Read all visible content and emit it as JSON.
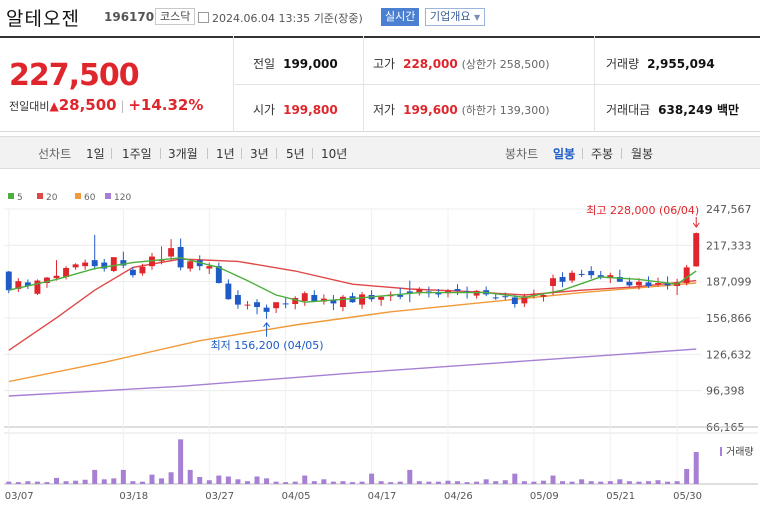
{
  "header": {
    "name": "알테오젠",
    "code": "196170",
    "market": "코스닥",
    "timestamp": "2024.06.04 13:35",
    "basis": "기준(장중)",
    "realtime_label": "실시간",
    "company_info_label": "기업개요"
  },
  "quote": {
    "price": "227,500",
    "change_label": "전일대비",
    "change": "28,500",
    "change_pct": "+14.32%",
    "prev_label": "전일",
    "prev": "199,000",
    "high_label": "고가",
    "high": "228,000",
    "upper_limit_label": "(상한가 258,500)",
    "volume_label": "거래량",
    "volume": "2,955,094",
    "open_label": "시가",
    "open": "199,800",
    "low_label": "저가",
    "low": "199,600",
    "lower_limit_label": "(하한가 139,300)",
    "amount_label": "거래대금",
    "amount": "638,249 백만"
  },
  "tabs": {
    "line_label": "선차트",
    "line_periods": [
      "1일",
      "1주일",
      "3개월",
      "1년",
      "3년",
      "5년",
      "10년"
    ],
    "candle_label": "봉차트",
    "candle_periods": [
      "일봉",
      "주봉",
      "월봉"
    ],
    "active": "일봉"
  },
  "colors": {
    "up": "#e0262d",
    "down": "#1f5bc6",
    "ma5": "#4cae3c",
    "ma20": "#e04848",
    "ma60": "#f09a3a",
    "ma120": "#a77fd4",
    "volume": "#a77fd4"
  },
  "chart_data": {
    "type": "candlestick",
    "ylim": [
      66165,
      247567
    ],
    "y_ticks": [
      "247,567",
      "217,333",
      "187,099",
      "156,866",
      "126,632",
      "96,398",
      "66,165"
    ],
    "x_tick_labels": [
      "03/07",
      "03/18",
      "03/27",
      "04/05",
      "04/17",
      "04/26",
      "05/09",
      "05/21",
      "05/30"
    ],
    "legend": [
      {
        "name": "5"
      },
      {
        "name": "20"
      },
      {
        "name": "60"
      },
      {
        "name": "120"
      }
    ],
    "max_annotation": "최고 228,000 (06/04)",
    "min_annotation": "최저 156,200 (04/05)",
    "volume_label": "거래량",
    "candles": [
      {
        "o": 195500,
        "h": 196000,
        "l": 177500,
        "c": 180000
      },
      {
        "o": 181000,
        "h": 190000,
        "l": 178500,
        "c": 187500
      },
      {
        "o": 186500,
        "h": 189000,
        "l": 181000,
        "c": 183500
      },
      {
        "o": 177000,
        "h": 189000,
        "l": 176000,
        "c": 188000
      },
      {
        "o": 186000,
        "h": 191000,
        "l": 182000,
        "c": 190500
      },
      {
        "o": 190000,
        "h": 205000,
        "l": 188000,
        "c": 192000
      },
      {
        "o": 191000,
        "h": 200000,
        "l": 189000,
        "c": 198500
      },
      {
        "o": 199000,
        "h": 202500,
        "l": 197000,
        "c": 201500
      },
      {
        "o": 200000,
        "h": 205500,
        "l": 197000,
        "c": 203000
      },
      {
        "o": 205000,
        "h": 226000,
        "l": 197000,
        "c": 200000
      },
      {
        "o": 203000,
        "h": 206000,
        "l": 195500,
        "c": 198000
      },
      {
        "o": 196000,
        "h": 207000,
        "l": 195000,
        "c": 207500
      },
      {
        "o": 205000,
        "h": 212000,
        "l": 198500,
        "c": 200500
      },
      {
        "o": 197000,
        "h": 199000,
        "l": 190500,
        "c": 192500
      },
      {
        "o": 194000,
        "h": 202000,
        "l": 192000,
        "c": 199500
      },
      {
        "o": 200000,
        "h": 211000,
        "l": 197000,
        "c": 208000
      },
      {
        "o": 205000,
        "h": 216500,
        "l": 201500,
        "c": 205000
      },
      {
        "o": 208000,
        "h": 222500,
        "l": 205000,
        "c": 215000
      },
      {
        "o": 216000,
        "h": 223000,
        "l": 196500,
        "c": 199000
      },
      {
        "o": 198000,
        "h": 205000,
        "l": 195500,
        "c": 204000
      },
      {
        "o": 205000,
        "h": 209000,
        "l": 196500,
        "c": 200000
      },
      {
        "o": 198000,
        "h": 203000,
        "l": 193500,
        "c": 200000
      },
      {
        "o": 200000,
        "h": 203000,
        "l": 185500,
        "c": 186000
      },
      {
        "o": 185500,
        "h": 189000,
        "l": 172000,
        "c": 172500
      },
      {
        "o": 176000,
        "h": 180000,
        "l": 164500,
        "c": 168000
      },
      {
        "o": 168000,
        "h": 171000,
        "l": 164000,
        "c": 168000
      },
      {
        "o": 170000,
        "h": 172500,
        "l": 160000,
        "c": 166000
      },
      {
        "o": 165500,
        "h": 168000,
        "l": 156200,
        "c": 162000
      },
      {
        "o": 165000,
        "h": 170000,
        "l": 161000,
        "c": 170000
      },
      {
        "o": 169000,
        "h": 174000,
        "l": 165000,
        "c": 168500
      },
      {
        "o": 168500,
        "h": 175000,
        "l": 164000,
        "c": 173500
      },
      {
        "o": 171000,
        "h": 179000,
        "l": 167000,
        "c": 177500
      },
      {
        "o": 176000,
        "h": 180000,
        "l": 170000,
        "c": 171000
      },
      {
        "o": 170500,
        "h": 176500,
        "l": 168000,
        "c": 173000
      },
      {
        "o": 172000,
        "h": 176000,
        "l": 163500,
        "c": 169000
      },
      {
        "o": 166000,
        "h": 176000,
        "l": 162500,
        "c": 174500
      },
      {
        "o": 175000,
        "h": 178000,
        "l": 169500,
        "c": 170000
      },
      {
        "o": 168000,
        "h": 178500,
        "l": 164500,
        "c": 176500
      },
      {
        "o": 176000,
        "h": 180000,
        "l": 170500,
        "c": 172500
      },
      {
        "o": 172000,
        "h": 175000,
        "l": 167000,
        "c": 174500
      },
      {
        "o": 175000,
        "h": 179000,
        "l": 171000,
        "c": 176500
      },
      {
        "o": 176000,
        "h": 182000,
        "l": 172500,
        "c": 174500
      },
      {
        "o": 179000,
        "h": 188000,
        "l": 170000,
        "c": 177000
      },
      {
        "o": 177500,
        "h": 182500,
        "l": 175500,
        "c": 181000
      },
      {
        "o": 179000,
        "h": 183000,
        "l": 174000,
        "c": 177500
      },
      {
        "o": 178000,
        "h": 181000,
        "l": 174000,
        "c": 176500
      },
      {
        "o": 177500,
        "h": 181000,
        "l": 174000,
        "c": 179500
      },
      {
        "o": 181000,
        "h": 185000,
        "l": 176000,
        "c": 179500
      },
      {
        "o": 179000,
        "h": 183000,
        "l": 173000,
        "c": 178000
      },
      {
        "o": 175500,
        "h": 180000,
        "l": 173000,
        "c": 179500
      },
      {
        "o": 180000,
        "h": 183000,
        "l": 175000,
        "c": 176500
      },
      {
        "o": 174000,
        "h": 177500,
        "l": 172000,
        "c": 173500
      },
      {
        "o": 175000,
        "h": 178000,
        "l": 172000,
        "c": 174500
      },
      {
        "o": 174000,
        "h": 176000,
        "l": 165500,
        "c": 168500
      },
      {
        "o": 169000,
        "h": 177000,
        "l": 166000,
        "c": 175000
      },
      {
        "o": 176000,
        "h": 180500,
        "l": 173000,
        "c": 176500
      },
      {
        "o": 174500,
        "h": 177500,
        "l": 170500,
        "c": 176000
      },
      {
        "o": 183500,
        "h": 193000,
        "l": 176000,
        "c": 190000
      },
      {
        "o": 191000,
        "h": 195000,
        "l": 182500,
        "c": 187000
      },
      {
        "o": 188000,
        "h": 196500,
        "l": 186000,
        "c": 194500
      },
      {
        "o": 193500,
        "h": 197000,
        "l": 191000,
        "c": 193000
      },
      {
        "o": 196000,
        "h": 200000,
        "l": 189500,
        "c": 192500
      },
      {
        "o": 192500,
        "h": 196000,
        "l": 189000,
        "c": 191000
      },
      {
        "o": 190000,
        "h": 194500,
        "l": 186000,
        "c": 192500
      },
      {
        "o": 191000,
        "h": 197000,
        "l": 187000,
        "c": 187000
      },
      {
        "o": 187000,
        "h": 190500,
        "l": 182500,
        "c": 184000
      },
      {
        "o": 184000,
        "h": 190000,
        "l": 180500,
        "c": 187000
      },
      {
        "o": 186500,
        "h": 191500,
        "l": 182000,
        "c": 183500
      },
      {
        "o": 185500,
        "h": 190500,
        "l": 183000,
        "c": 186000
      },
      {
        "o": 185500,
        "h": 191500,
        "l": 180500,
        "c": 184000
      },
      {
        "o": 183500,
        "h": 189500,
        "l": 176000,
        "c": 186500
      },
      {
        "o": 186000,
        "h": 201000,
        "l": 184000,
        "c": 199000
      },
      {
        "o": 199800,
        "h": 228000,
        "l": 199600,
        "c": 227500
      }
    ],
    "ma5": [
      [
        0,
        180000
      ],
      [
        5,
        189000
      ],
      [
        9,
        198000
      ],
      [
        13,
        203000
      ],
      [
        18,
        207000
      ],
      [
        22,
        199000
      ],
      [
        25,
        188000
      ],
      [
        28,
        176000
      ],
      [
        31,
        170000
      ],
      [
        36,
        173000
      ],
      [
        43,
        178000
      ],
      [
        50,
        178000
      ],
      [
        54,
        174000
      ],
      [
        58,
        180000
      ],
      [
        62,
        191000
      ],
      [
        66,
        189000
      ],
      [
        70,
        185000
      ],
      [
        72,
        196000
      ]
    ],
    "ma20": [
      [
        0,
        130000
      ],
      [
        5,
        157000
      ],
      [
        9,
        180000
      ],
      [
        13,
        199000
      ],
      [
        18,
        206000
      ],
      [
        24,
        204000
      ],
      [
        30,
        196000
      ],
      [
        36,
        185000
      ],
      [
        42,
        181000
      ],
      [
        48,
        179000
      ],
      [
        54,
        176000
      ],
      [
        60,
        180000
      ],
      [
        66,
        183000
      ],
      [
        72,
        188000
      ]
    ],
    "ma60": [
      [
        0,
        104000
      ],
      [
        10,
        120000
      ],
      [
        20,
        138000
      ],
      [
        30,
        151000
      ],
      [
        40,
        162000
      ],
      [
        50,
        170000
      ],
      [
        60,
        178000
      ],
      [
        66,
        182000
      ],
      [
        72,
        186000
      ]
    ],
    "ma120": [
      [
        0,
        92000
      ],
      [
        18,
        100000
      ],
      [
        36,
        111000
      ],
      [
        54,
        121000
      ],
      [
        72,
        131000
      ]
    ],
    "volume": [
      0.05,
      0.04,
      0.06,
      0.05,
      0.04,
      0.13,
      0.06,
      0.07,
      0.09,
      0.3,
      0.1,
      0.12,
      0.3,
      0.06,
      0.05,
      0.2,
      0.12,
      0.25,
      0.95,
      0.3,
      0.15,
      0.08,
      0.18,
      0.16,
      0.1,
      0.06,
      0.16,
      0.12,
      0.05,
      0.04,
      0.05,
      0.18,
      0.06,
      0.1,
      0.05,
      0.06,
      0.04,
      0.05,
      0.22,
      0.06,
      0.04,
      0.05,
      0.3,
      0.06,
      0.05,
      0.05,
      0.07,
      0.06,
      0.04,
      0.05,
      0.1,
      0.06,
      0.08,
      0.22,
      0.06,
      0.05,
      0.07,
      0.18,
      0.06,
      0.05,
      0.1,
      0.06,
      0.05,
      0.06,
      0.1,
      0.06,
      0.05,
      0.06,
      0.08,
      0.05,
      0.06,
      0.32,
      0.68
    ]
  }
}
